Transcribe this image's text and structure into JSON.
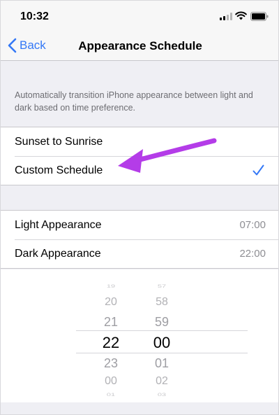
{
  "status_bar": {
    "time": "10:32"
  },
  "nav": {
    "back_label": "Back",
    "title": "Appearance Schedule"
  },
  "description": "Automatically transition iPhone appearance between light and dark based on time preference.",
  "schedule_options": [
    {
      "label": "Sunset to Sunrise",
      "selected": false
    },
    {
      "label": "Custom Schedule",
      "selected": true
    }
  ],
  "appearance_times": [
    {
      "label": "Light Appearance",
      "value": "07:00"
    },
    {
      "label": "Dark Appearance",
      "value": "22:00"
    }
  ],
  "picker": {
    "hours": [
      "19",
      "20",
      "21",
      "22",
      "23",
      "00",
      "01"
    ],
    "minutes": [
      "57",
      "58",
      "59",
      "00",
      "01",
      "02",
      "03"
    ],
    "selected_hour": "22",
    "selected_minute": "00"
  },
  "colors": {
    "accent": "#3478f6",
    "annotation_arrow": "#b43ce8",
    "background": "#efeff4"
  },
  "icons": [
    "cellular-signal-icon",
    "wifi-icon",
    "battery-icon",
    "chevron-left-icon",
    "checkmark-icon",
    "annotation-arrow"
  ]
}
